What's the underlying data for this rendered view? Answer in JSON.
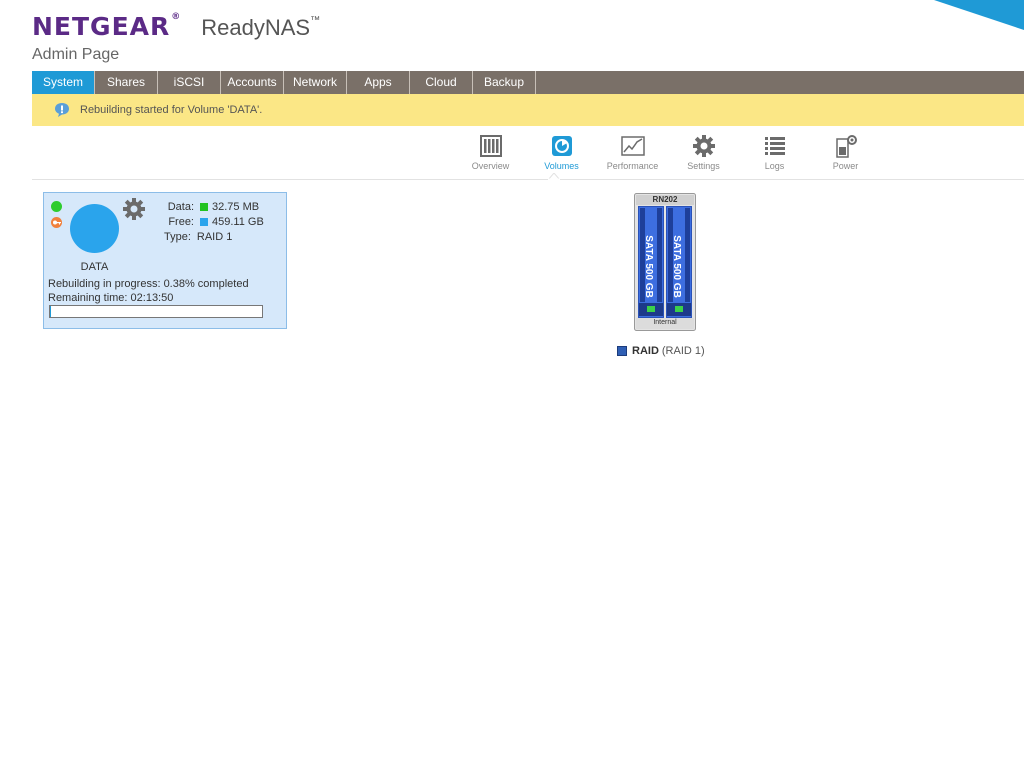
{
  "header": {
    "logo": "NETGEAR",
    "logo_mark": "®",
    "product": "ReadyNAS",
    "product_mark": "™",
    "subtitle": "Admin Page"
  },
  "nav": {
    "tabs": [
      {
        "label": "System",
        "active": true
      },
      {
        "label": "Shares",
        "active": false
      },
      {
        "label": "iSCSI",
        "active": false
      },
      {
        "label": "Accounts",
        "active": false
      },
      {
        "label": "Network",
        "active": false
      },
      {
        "label": "Apps",
        "active": false
      },
      {
        "label": "Cloud",
        "active": false
      },
      {
        "label": "Backup",
        "active": false
      }
    ]
  },
  "notice": {
    "message": "Rebuilding started for Volume 'DATA'.",
    "icon": "speech-bubble-icon"
  },
  "subnav": {
    "items": [
      {
        "label": "Overview",
        "icon": "overview-icon"
      },
      {
        "label": "Volumes",
        "icon": "volumes-icon",
        "active": true
      },
      {
        "label": "Performance",
        "icon": "performance-icon"
      },
      {
        "label": "Settings",
        "icon": "settings-icon"
      },
      {
        "label": "Logs",
        "icon": "logs-icon"
      },
      {
        "label": "Power",
        "icon": "power-icon"
      }
    ]
  },
  "volume": {
    "name": "DATA",
    "data_label": "Data:",
    "data_value": "32.75 MB",
    "free_label": "Free:",
    "free_value": "459.11 GB",
    "type_label": "Type:",
    "type_value": "RAID 1",
    "rebuild_text": "Rebuilding in progress: 0.38% completed",
    "remaining_text": "Remaining time: 02:13:50",
    "progress": 0.0038,
    "data_color": "#22c322",
    "free_color": "#2aa4ec"
  },
  "enclosure": {
    "model": "RN202",
    "bay_label": "Internal",
    "disks": [
      "SATA 500 GB",
      "SATA 500 GB"
    ]
  },
  "raid_legend": {
    "name": "RAID",
    "level": "(RAID 1)",
    "color": "#2f5fb4"
  },
  "colors": {
    "accent": "#1f9ad6",
    "brand": "#5b2a86",
    "nav_bg": "#7a7068",
    "notice_bg": "#fbe786"
  }
}
